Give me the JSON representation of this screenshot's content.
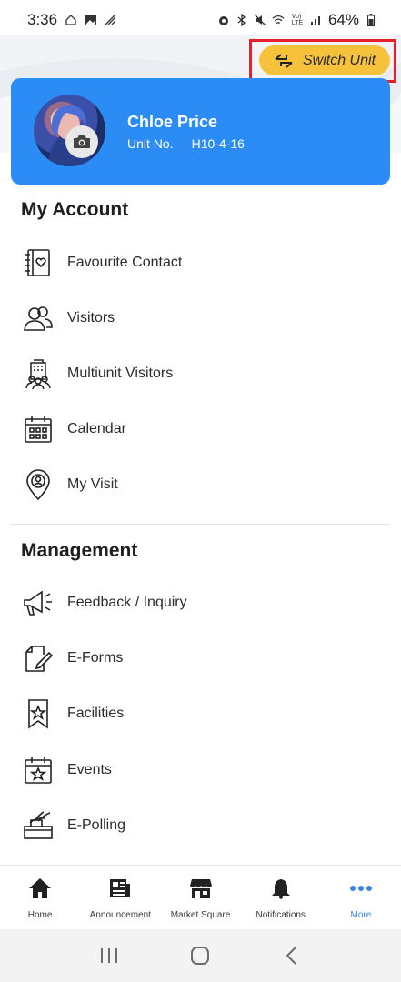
{
  "status_bar": {
    "time": "3:36",
    "battery": "64%"
  },
  "header": {
    "switch_unit_label": "Switch Unit"
  },
  "profile": {
    "name": "Chloe Price",
    "unit_label": "Unit No.",
    "unit_value": "H10-4-16"
  },
  "sections": {
    "my_account": {
      "title": "My Account",
      "items": [
        {
          "label": "Favourite Contact",
          "icon": "address-book-heart-icon"
        },
        {
          "label": "Visitors",
          "icon": "users-icon"
        },
        {
          "label": "Multiunit Visitors",
          "icon": "building-people-icon"
        },
        {
          "label": "Calendar",
          "icon": "calendar-icon"
        },
        {
          "label": "My Visit",
          "icon": "location-pin-user-icon"
        }
      ]
    },
    "management": {
      "title": "Management",
      "items": [
        {
          "label": "Feedback / Inquiry",
          "icon": "megaphone-icon"
        },
        {
          "label": "E-Forms",
          "icon": "form-pencil-icon"
        },
        {
          "label": "Facilities",
          "icon": "bookmark-star-icon"
        },
        {
          "label": "Events",
          "icon": "calendar-star-icon"
        },
        {
          "label": "E-Polling",
          "icon": "ballot-box-icon"
        }
      ]
    }
  },
  "bottom_nav": [
    {
      "label": "Home",
      "icon": "home-icon"
    },
    {
      "label": "Announcement",
      "icon": "newspaper-icon"
    },
    {
      "label": "Market Square",
      "icon": "store-icon"
    },
    {
      "label": "Notifications",
      "icon": "bell-icon"
    },
    {
      "label": "More",
      "icon": "more-dots-icon",
      "active": true
    }
  ],
  "colors": {
    "accent": "#2b8cf6",
    "switch_button": "#f6c23c",
    "highlight": "#e3202b",
    "active_nav": "#3a86e6"
  }
}
